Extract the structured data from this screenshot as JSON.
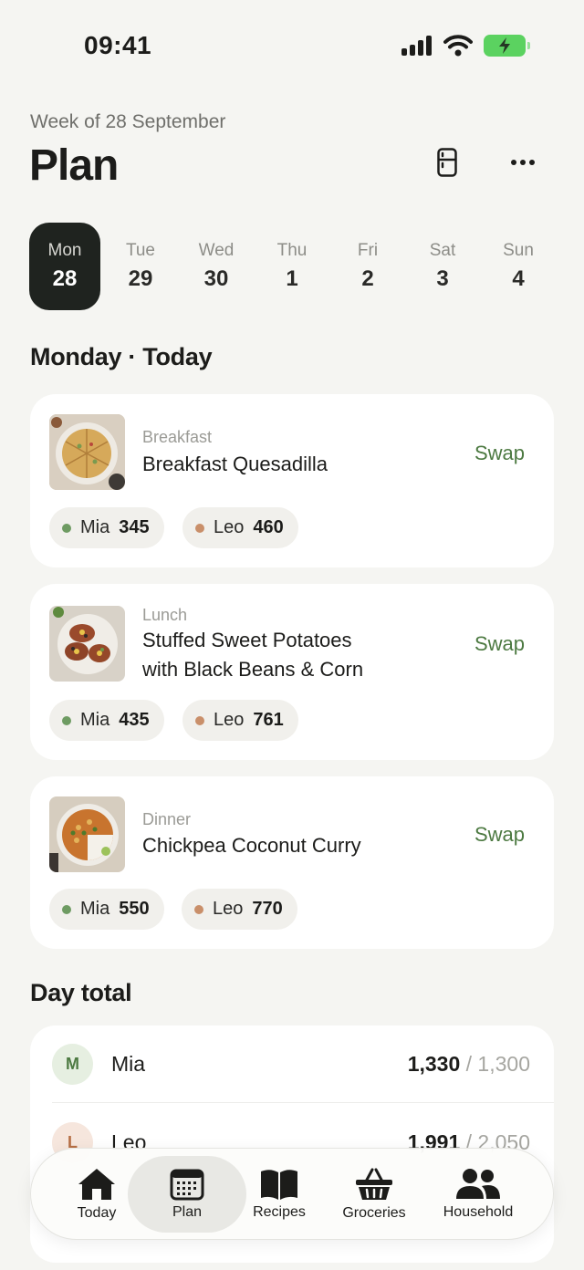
{
  "status": {
    "time": "09:41"
  },
  "header": {
    "subtitle": "Week of 28 September",
    "title": "Plan",
    "icons": [
      "fridge-icon",
      "more-icon"
    ]
  },
  "week": [
    {
      "name": "Mon",
      "num": "28",
      "selected": true
    },
    {
      "name": "Tue",
      "num": "29"
    },
    {
      "name": "Wed",
      "num": "30"
    },
    {
      "name": "Thu",
      "num": "1"
    },
    {
      "name": "Fri",
      "num": "2"
    },
    {
      "name": "Sat",
      "num": "3"
    },
    {
      "name": "Sun",
      "num": "4"
    }
  ],
  "today": {
    "heading": "Monday · Today",
    "swap_label": "Swap",
    "meals": [
      {
        "type": "Breakfast",
        "name": "Breakfast Quesadilla",
        "mia": {
          "name": "Mia",
          "kcal": "345"
        },
        "leo": {
          "name": "Leo",
          "kcal": "460"
        }
      },
      {
        "type": "Lunch",
        "name_line1": "Stuffed Sweet Potatoes",
        "name_line2": "with Black Beans & Corn",
        "mia": {
          "name": "Mia",
          "kcal": "435"
        },
        "leo": {
          "name": "Leo",
          "kcal": "761"
        }
      },
      {
        "type": "Dinner",
        "name": "Chickpea Coconut Curry",
        "mia": {
          "name": "Mia",
          "kcal": "550"
        },
        "leo": {
          "name": "Leo",
          "kcal": "770"
        }
      }
    ]
  },
  "day_total": {
    "heading": "Day total",
    "rows": [
      {
        "initial": "M",
        "name": "Mia",
        "value": "1,330",
        "target": "/ 1,300"
      },
      {
        "initial": "L",
        "name": "Leo",
        "value": "1,991",
        "target": "/ 2,050"
      }
    ]
  },
  "tabs": [
    {
      "label": "Today",
      "icon": "home-icon"
    },
    {
      "label": "Plan",
      "icon": "calendar-icon",
      "active": true
    },
    {
      "label": "Recipes",
      "icon": "book-icon"
    },
    {
      "label": "Groceries",
      "icon": "basket-icon"
    },
    {
      "label": "Household",
      "icon": "people-icon"
    }
  ],
  "colors": {
    "accent_green": "#4d7a42",
    "mia_dot": "#6e9b62",
    "leo_dot": "#c98f6a",
    "selected_day_bg": "#1f231f",
    "battery": "#5bd260"
  }
}
